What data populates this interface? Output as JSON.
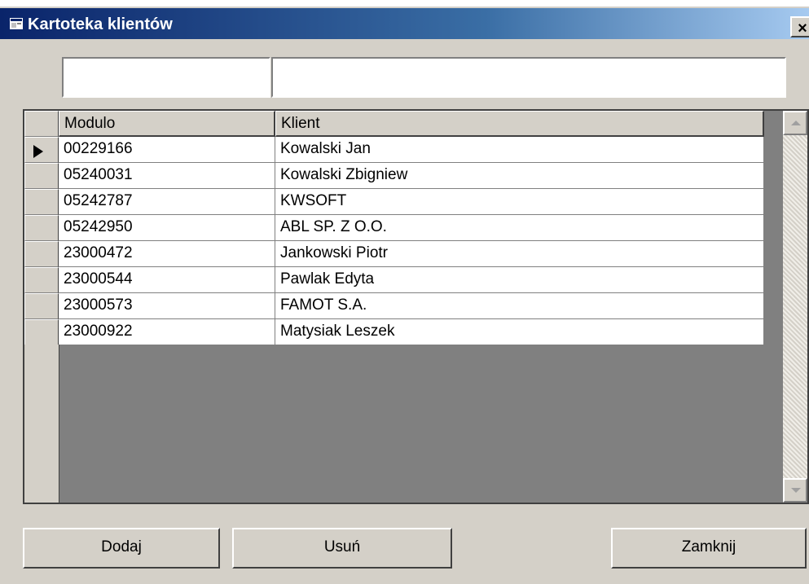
{
  "window": {
    "title": "Kartoteka klientów",
    "close_label": "×"
  },
  "filters": {
    "modulo_value": "",
    "client_value": ""
  },
  "grid": {
    "columns": [
      "Modulo",
      "Klient"
    ],
    "rows": [
      {
        "modulo": "00229166",
        "client": "Kowalski Jan",
        "current": true
      },
      {
        "modulo": "05240031",
        "client": "Kowalski Zbigniew"
      },
      {
        "modulo": "05242787",
        "client": "KWSOFT"
      },
      {
        "modulo": "05242950",
        "client": "ABL SP. Z O.O."
      },
      {
        "modulo": "23000472",
        "client": "Jankowski Piotr"
      },
      {
        "modulo": "23000544",
        "client": "Pawlak Edyta"
      },
      {
        "modulo": "23000573",
        "client": "FAMOT S.A."
      },
      {
        "modulo": "23000922",
        "client": "Matysiak Leszek"
      }
    ]
  },
  "buttons": {
    "add": "Dodaj",
    "delete": "Usuń",
    "close": "Zamknij"
  },
  "icons": {
    "window": "window-icon",
    "current_row": "row-pointer-icon"
  },
  "colors": {
    "face": "#d4d0c8",
    "title_start": "#0a246a",
    "title_end": "#a6caf0"
  }
}
